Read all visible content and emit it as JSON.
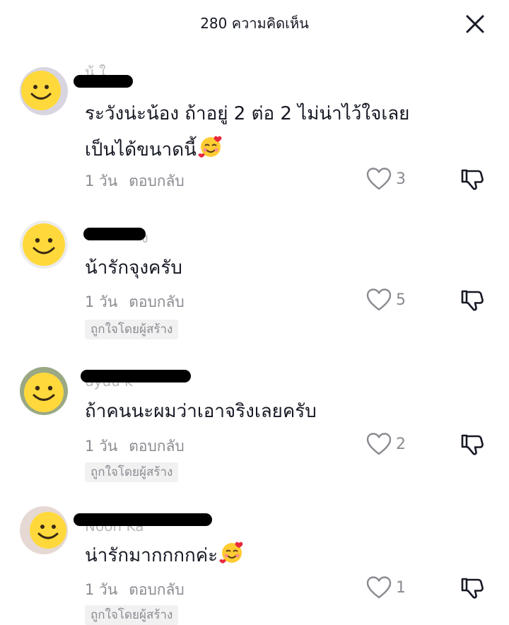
{
  "header": {
    "title": "280 ความคิดเห็น",
    "close_icon": "close-icon"
  },
  "colors": {
    "text": "#161823",
    "muted": "#8a8b91",
    "badge_bg": "#f1f1f2",
    "avatar_face": "#ffd93b"
  },
  "comments": [
    {
      "username_visible_fragment": "น้ ใ",
      "text_lines": [
        "ระวังน่ะน้อง ถ้าอยู่ 2 ต่อ 2 ไม่น่าไว้ใจเลย",
        "เป็นได้ขนาดนี้"
      ],
      "trailing_emoji": "smiling-face-with-hearts",
      "time": "1 วัน",
      "reply_label": "ตอบกลับ",
      "likes": "3",
      "badge": ""
    },
    {
      "username_visible_fragment": "ง",
      "text_lines": [
        "น้ารักจุงครับ"
      ],
      "time": "1 วัน",
      "reply_label": "ตอบกลับ",
      "likes": "5",
      "badge": "ถูกใจโดยผู้สร้าง"
    },
    {
      "username_visible_fragment": "uyuu k",
      "text_lines": [
        "ถ้าคนนะผมว่าเอาจริงเลยครับ"
      ],
      "time": "1 วัน",
      "reply_label": "ตอบกลับ",
      "likes": "2",
      "badge": "ถูกใจโดยผู้สร้าง"
    },
    {
      "username_visible_fragment": "Noon Ka",
      "text_lines": [
        "น่ารักมากกกกค่ะ"
      ],
      "trailing_emoji": "smiling-face-with-hearts",
      "time": "1 วัน",
      "reply_label": "ตอบกลับ",
      "likes": "1",
      "badge": "ถูกใจโดยผู้สร้าง"
    }
  ]
}
